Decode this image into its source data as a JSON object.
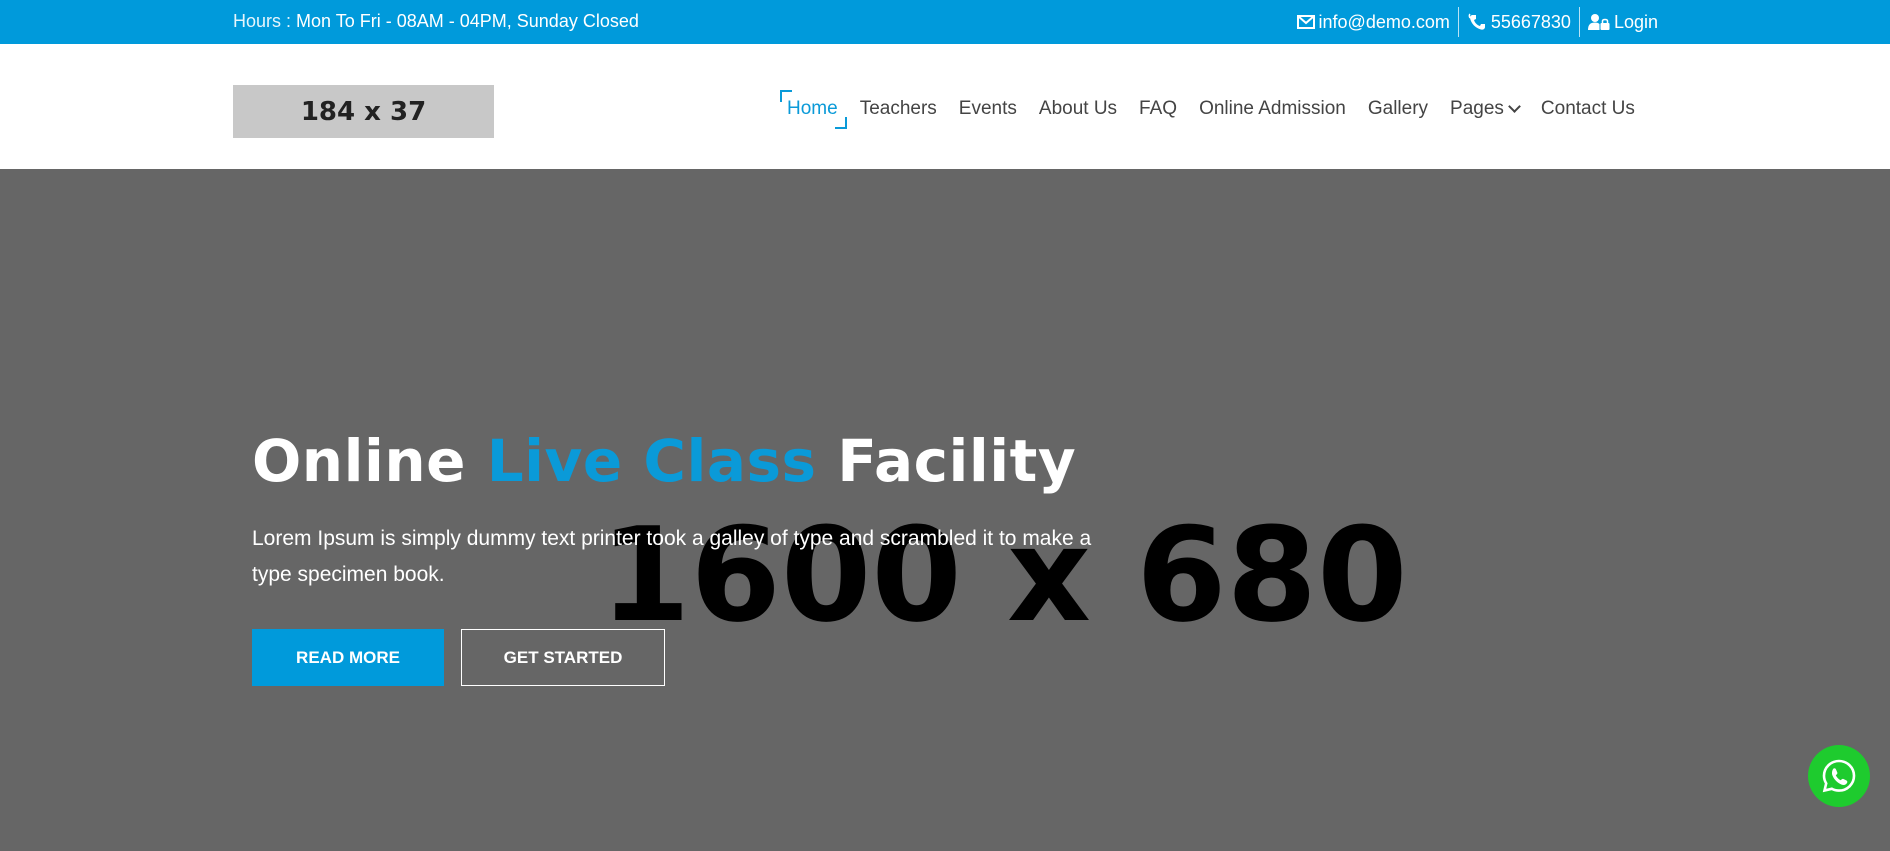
{
  "topbar": {
    "hours_label": "Hours :",
    "hours_value": "Mon To Fri - 08AM - 04PM, Sunday Closed",
    "email": "info@demo.com",
    "phone": "55667830",
    "login": "Login",
    "color": "#009adb"
  },
  "header": {
    "logo_text": "184 x 37",
    "nav": [
      "Home",
      "Teachers",
      "Events",
      "About Us",
      "FAQ",
      "Online Admission",
      "Gallery",
      "Pages",
      "Contact Us"
    ],
    "active": "Home",
    "accent": "#0a9ad8"
  },
  "hero": {
    "placeholder_text": "1600 x 680",
    "title_part1": "Online",
    "title_accent": "Live Class",
    "title_part2": "Facility",
    "description": "Lorem Ipsum is simply dummy text printer took a galley of type and scrambled it to make a type specimen book.",
    "btn_read_more": "READ MORE",
    "btn_get_started": "GET STARTED"
  },
  "icons": [
    "envelope-icon",
    "phone-icon",
    "user-lock-icon",
    "chevron-down-icon",
    "whatsapp-icon"
  ]
}
